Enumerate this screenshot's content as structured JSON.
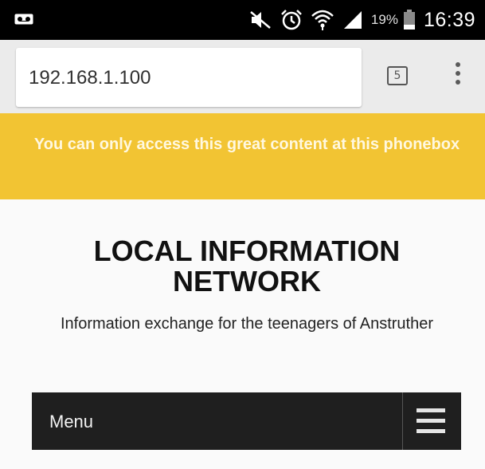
{
  "status_bar": {
    "battery_percent": "19%",
    "time": "16:39",
    "icons": [
      "voicemail-icon",
      "mute-icon",
      "alarm-icon",
      "wifi-icon",
      "signal-icon",
      "battery-icon"
    ]
  },
  "browser": {
    "url": "192.168.1.100",
    "tab_count": "5",
    "icons": [
      "tab-switcher-icon",
      "overflow-menu-icon"
    ]
  },
  "banner": {
    "text": "You can only access this great content at this phonebox",
    "color": "#f2c433"
  },
  "site": {
    "title": "LOCAL INFORMATION NETWORK",
    "tagline": "Information exchange for the teenagers of Anstruther"
  },
  "nav": {
    "menu_label": "Menu",
    "toggle_icon": "hamburger-icon",
    "color": "#1f1f1f"
  }
}
